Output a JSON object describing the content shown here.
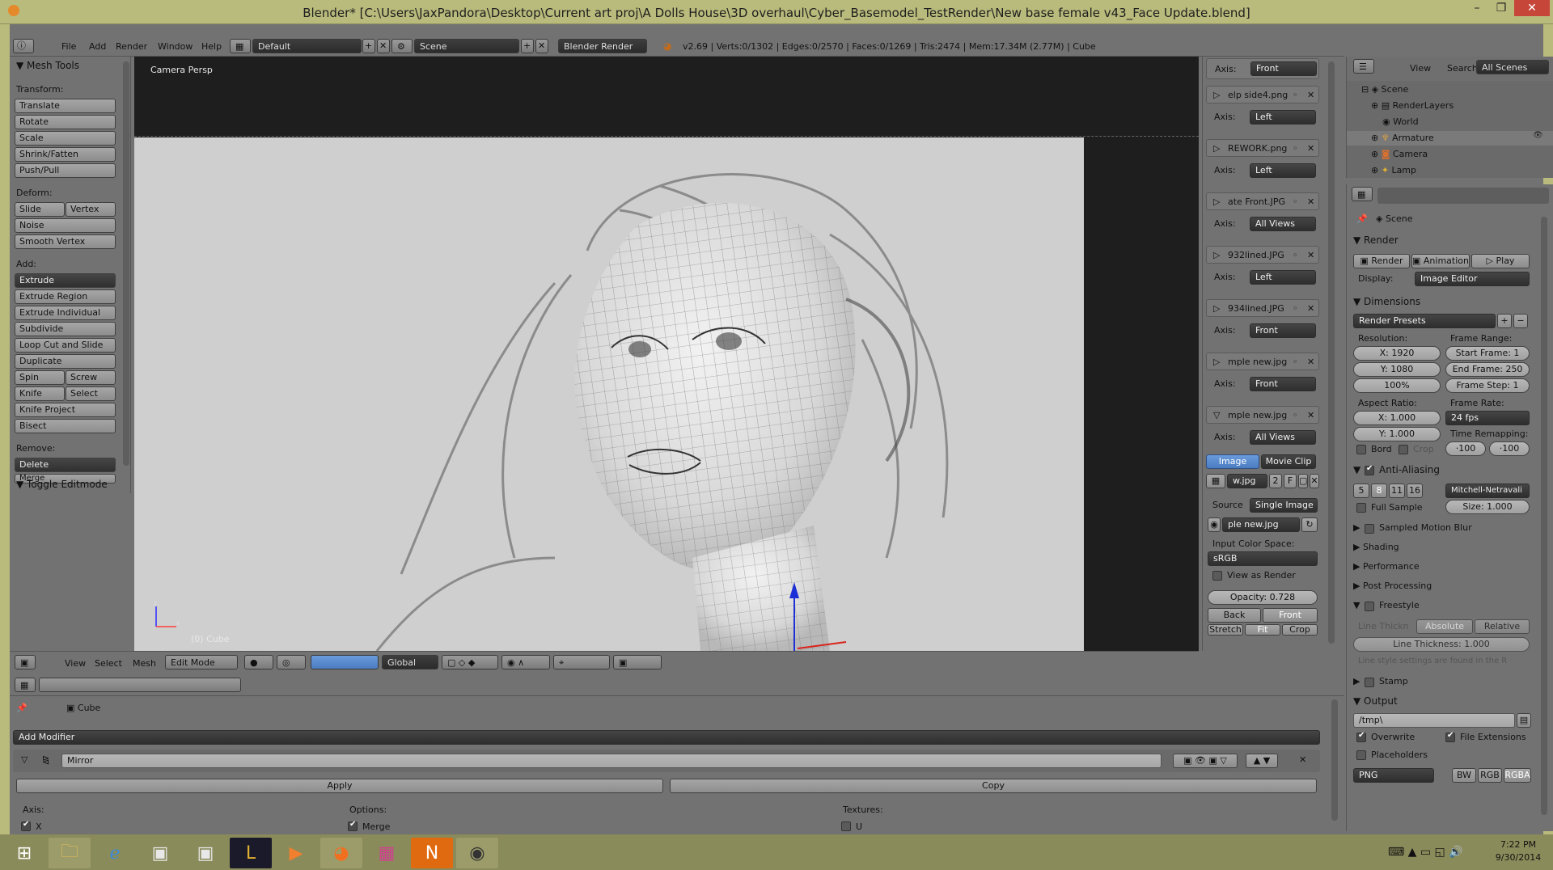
{
  "titlebar": {
    "title": "Blender* [C:\\Users\\JaxPandora\\Desktop\\Current art proj\\A Dolls House\\3D overhaul\\Cyber_Basemodel_TestRender\\New base female v43_Face Update.blend]",
    "min": "–",
    "max": "❐",
    "close": "✕"
  },
  "info": {
    "menus": [
      "File",
      "Add",
      "Render",
      "Window",
      "Help"
    ],
    "layout": "Default",
    "scene": "Scene",
    "engine": "Blender Render",
    "stats": "v2.69 | Verts:0/1302 | Edges:0/2570 | Faces:0/1269 | Tris:2474 | Mem:17.34M (2.77M) | Cube"
  },
  "toolshelf": {
    "title": "Mesh Tools",
    "transform_label": "Transform:",
    "transform": [
      "Translate",
      "Rotate",
      "Scale",
      "Shrink/Fatten",
      "Push/Pull"
    ],
    "deform_label": "Deform:",
    "slide_edge": "Slide Edge",
    "vertex": "Vertex",
    "deform": [
      "Noise",
      "Smooth Vertex"
    ],
    "add_label": "Add:",
    "extrude": "Extrude",
    "add": [
      "Extrude Region",
      "Extrude Individual",
      "Subdivide",
      "Loop Cut and Slide",
      "Duplicate"
    ],
    "spin": "Spin",
    "screw": "Screw",
    "knife": "Knife",
    "select": "Select",
    "knife_project": "Knife Project",
    "bisect": "Bisect",
    "remove_label": "Remove:",
    "delete": "Delete",
    "merge": "Merge",
    "toggle": "Toggle Editmode"
  },
  "viewport": {
    "label": "Camera Persp",
    "object_label": "(0) Cube"
  },
  "image_panel": {
    "top_axis": "Front",
    "images": [
      {
        "name": "elp side4.png",
        "axis": "Left"
      },
      {
        "name": "REWORK.png",
        "axis": "Left"
      },
      {
        "name": "ate Front.JPG",
        "axis": "All Views"
      },
      {
        "name": "932lined.JPG",
        "axis": "Left"
      },
      {
        "name": "934lined.JPG",
        "axis": "Front"
      },
      {
        "name": "mple new.jpg",
        "axis": "Front"
      },
      {
        "name": "mple new.jpg",
        "axis": "All Views"
      }
    ],
    "axis_label": "Axis:",
    "tab_image": "Image",
    "tab_movie": "Movie Clip",
    "file_field": "w.jpg",
    "users": "2",
    "fake": "F",
    "source_label": "Source",
    "source": "Single Image",
    "file2": "ple new.jpg",
    "color_space_label": "Input Color Space:",
    "color_space": "sRGB",
    "view_as_render": "View as Render",
    "opacity": "Opacity: 0.728",
    "back": "Back",
    "front": "Front",
    "stretch": "Stretch",
    "fit": "Fit",
    "crop": "Crop"
  },
  "outliner": {
    "view": "View",
    "search": "Search",
    "scenes": "All Scenes",
    "items": [
      "Scene",
      "RenderLayers",
      "World",
      "Armature",
      "Camera",
      "Lamp"
    ]
  },
  "properties": {
    "scene": "Scene",
    "render_panel": "Render",
    "render_btn": "Render",
    "animation_btn": "Animation",
    "play_btn": "Play",
    "display_label": "Display:",
    "display": "Image Editor",
    "dimensions": "Dimensions",
    "presets": "Render Presets",
    "resolution_label": "Resolution:",
    "res_x": "X: 1920",
    "res_y": "Y: 1080",
    "res_pct": "100%",
    "frame_range_label": "Frame Range:",
    "start": "Start Frame: 1",
    "end": "End Frame: 250",
    "step": "Frame Step: 1",
    "aspect_label": "Aspect Ratio:",
    "asp_x": "X: 1.000",
    "asp_y": "Y: 1.000",
    "frame_rate_label": "Frame Rate:",
    "fps": "24 fps",
    "time_remap_label": "Time Remapping:",
    "remap_old": "·100",
    "remap_new": "·100",
    "bord": "Bord",
    "crop": "Crop",
    "antialiasing": "Anti-Aliasing",
    "aa_samples": [
      "5",
      "8",
      "11",
      "16"
    ],
    "aa_filter": "Mitchell-Netravali",
    "full_sample": "Full Sample",
    "aa_size": "Size: 1.000",
    "motion_blur": "Sampled Motion Blur",
    "shading": "Shading",
    "performance": "Performance",
    "post": "Post Processing",
    "freestyle": "Freestyle",
    "line_thick_label": "Line Thickn",
    "absolute": "Absolute",
    "relative": "Relative",
    "line_thickness": "Line Thickness: 1.000",
    "line_note": "Line style settings are found in the R",
    "stamp": "Stamp",
    "output": "Output",
    "path": "/tmp\\",
    "overwrite": "Overwrite",
    "file_ext": "File Extensions",
    "placeholders": "Placeholders",
    "format": "PNG",
    "bw": "BW",
    "rgb": "RGB",
    "rgba": "RGBA"
  },
  "vphead": {
    "view": "View",
    "select": "Select",
    "mesh": "Mesh",
    "mode": "Edit Mode",
    "orientation": "Global"
  },
  "modifiers": {
    "object": "Cube",
    "add_modifier": "Add Modifier",
    "name": "Mirror",
    "apply": "Apply",
    "copy": "Copy",
    "axis_label": "Axis:",
    "options_label": "Options:",
    "textures_label": "Textures:",
    "x": "X",
    "merge": "Merge",
    "u": "U"
  },
  "taskbar": {
    "time": "7:22 PM",
    "date": "9/30/2014"
  },
  "colors": {
    "accent_blue": "#5b8fd6",
    "titlebar": "#b9bb7c",
    "taskbar": "#8a8b5a"
  }
}
